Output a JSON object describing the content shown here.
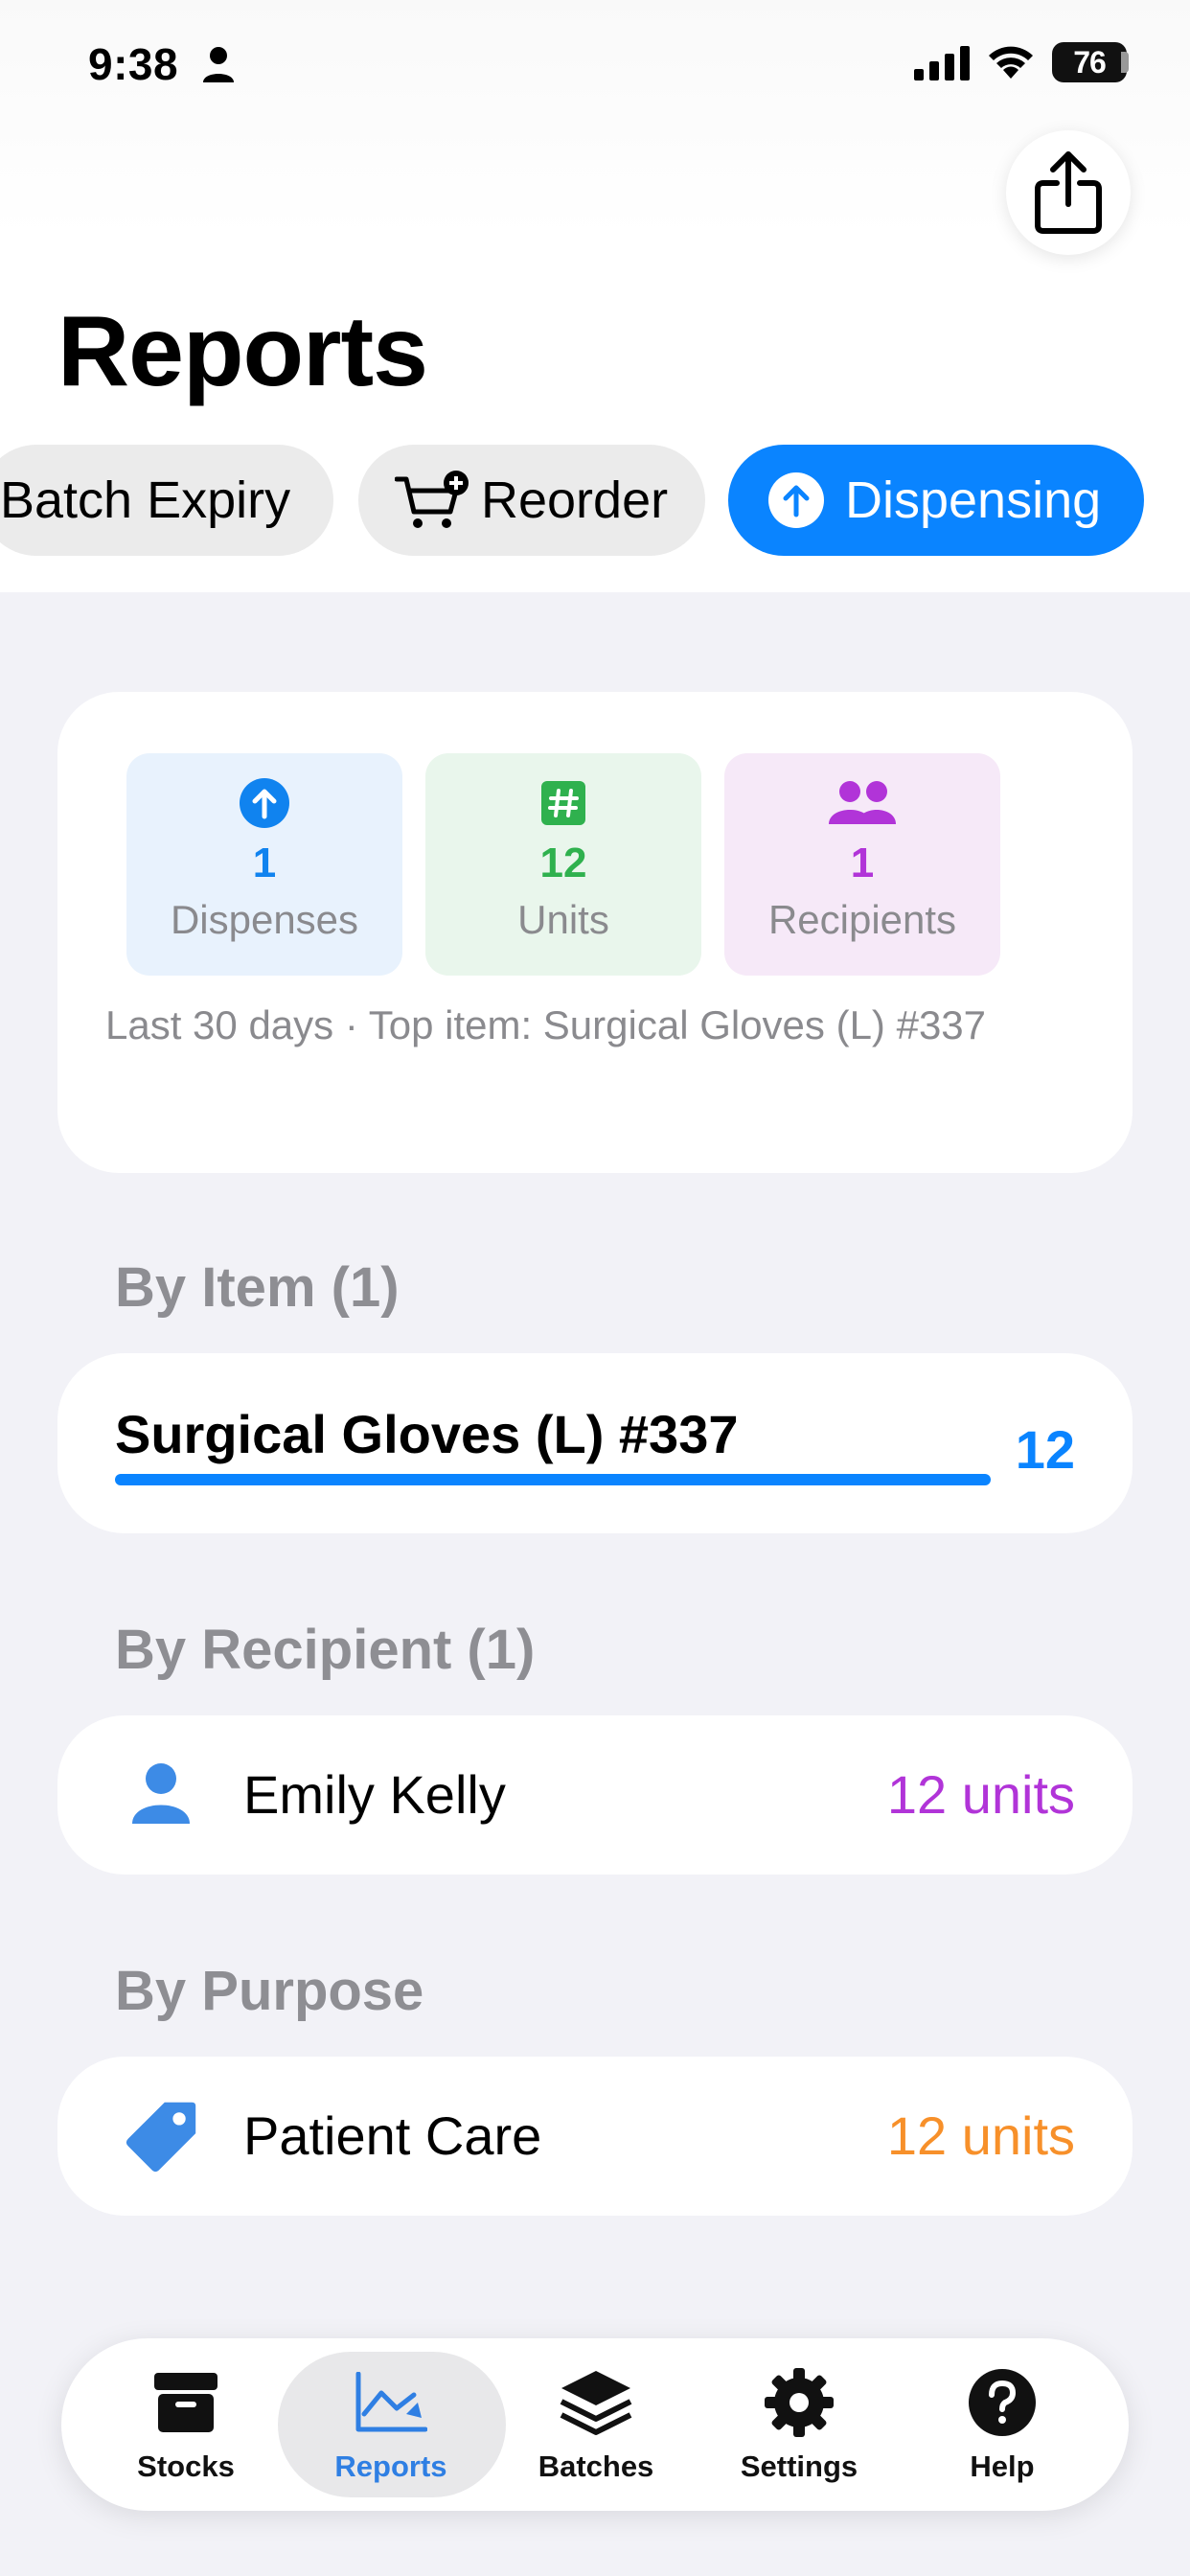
{
  "status_bar": {
    "time": "9:38",
    "battery": "76"
  },
  "header": {
    "title": "Reports"
  },
  "filters": [
    {
      "label": "Batch Expiry"
    },
    {
      "label": "Reorder"
    },
    {
      "label": "Dispensing",
      "selected": true
    }
  ],
  "summary": {
    "stats": [
      {
        "value": "1",
        "label": "Dispenses",
        "icon": "arrow-up-circle-icon",
        "color": "#1083ef"
      },
      {
        "value": "12",
        "label": "Units",
        "icon": "number-square-icon",
        "color": "#2fb14e"
      },
      {
        "value": "1",
        "label": "Recipients",
        "icon": "people-icon",
        "color": "#b134d8"
      }
    ],
    "note": "Last 30 days · Top item: Surgical Gloves (L) #337"
  },
  "by_item": {
    "header": "By Item (1)",
    "items": [
      {
        "name": "Surgical Gloves (L) #337",
        "count": "12",
        "bar_fraction": 1.0
      }
    ]
  },
  "by_recipient": {
    "header": "By Recipient (1)",
    "items": [
      {
        "name": "Emily Kelly",
        "value": "12 units",
        "icon": "person-icon"
      }
    ]
  },
  "by_purpose": {
    "header": "By Purpose",
    "items": [
      {
        "name": "Patient Care",
        "value": "12 units",
        "icon": "tag-icon"
      }
    ]
  },
  "tab_bar": {
    "tabs": [
      {
        "label": "Stocks",
        "icon": "archivebox-icon"
      },
      {
        "label": "Reports",
        "icon": "chart-icon",
        "active": true
      },
      {
        "label": "Batches",
        "icon": "layers-icon"
      },
      {
        "label": "Settings",
        "icon": "gear-icon"
      },
      {
        "label": "Help",
        "icon": "help-icon"
      }
    ]
  },
  "colors": {
    "accent": "#0a84ff",
    "recipient": "#b134d8",
    "purpose": "#f7902a"
  }
}
